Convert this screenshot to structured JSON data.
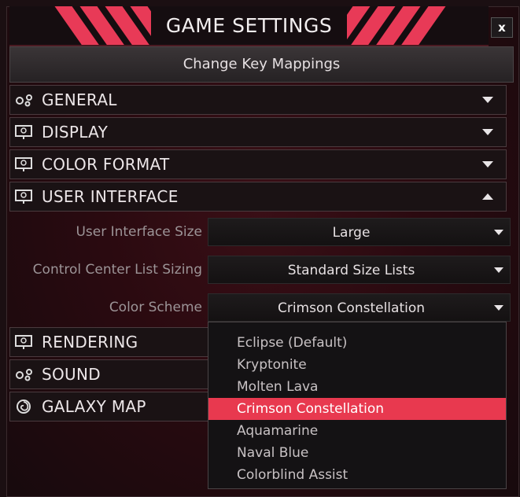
{
  "window": {
    "title": "GAME SETTINGS",
    "close_label": "x",
    "accent_color": "#e8394f"
  },
  "toolbar": {
    "key_mappings_label": "Change Key Mappings"
  },
  "sections": [
    {
      "label": "GENERAL",
      "icon": "gears-icon",
      "state": "collapsed"
    },
    {
      "label": "DISPLAY",
      "icon": "monitor-icon",
      "state": "collapsed"
    },
    {
      "label": "COLOR FORMAT",
      "icon": "monitor-icon",
      "state": "collapsed"
    },
    {
      "label": "USER INTERFACE",
      "icon": "monitor-icon",
      "state": "expanded"
    },
    {
      "label": "RENDERING",
      "icon": "monitor-icon",
      "state": "collapsed"
    },
    {
      "label": "SOUND",
      "icon": "gears-icon",
      "state": "collapsed"
    },
    {
      "label": "GALAXY MAP",
      "icon": "galaxy-icon",
      "state": "collapsed"
    }
  ],
  "user_interface": {
    "ui_size": {
      "label": "User Interface Size",
      "value": "Large"
    },
    "list_sizing": {
      "label": "Control Center List Sizing",
      "value": "Standard Size Lists"
    },
    "color_scheme": {
      "label": "Color Scheme",
      "value": "Crimson Constellation",
      "options": [
        "Eclipse (Default)",
        "Kryptonite",
        "Molten Lava",
        "Crimson Constellation",
        "Aquamarine",
        "Naval Blue",
        "Colorblind Assist"
      ],
      "selected": "Crimson Constellation"
    }
  }
}
